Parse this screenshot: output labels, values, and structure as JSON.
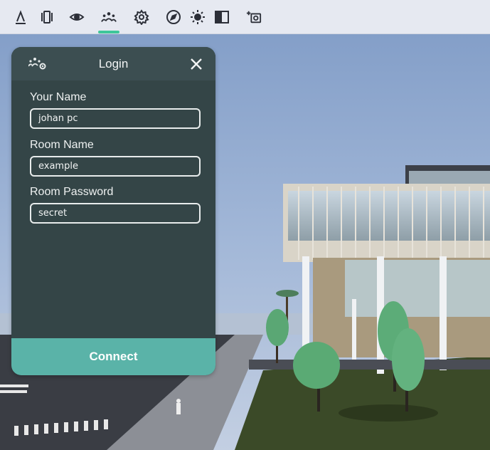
{
  "colors": {
    "panel_bg": "#344547",
    "panel_header_bg": "#3c4e51",
    "accent": "#5ab3a8",
    "active_tab_indicator": "#3ec69a",
    "toolbar_bg": "#e6e9f1",
    "toolbar_icon": "#2c2f38"
  },
  "toolbar": {
    "buttons": [
      {
        "icon": "measure-icon"
      },
      {
        "icon": "layers-icon"
      },
      {
        "icon": "eye-icon"
      },
      {
        "icon": "collaboration-icon",
        "active": true
      },
      {
        "icon": "settings-gear-icon"
      },
      {
        "icon": "compass-icon"
      },
      {
        "icon": "sun-icon"
      },
      {
        "icon": "split-view-icon"
      },
      {
        "icon": "camera-sparkle-icon"
      }
    ]
  },
  "login": {
    "title": "Login",
    "header_icon": "collaboration-settings-icon",
    "close_icon": "close-icon",
    "fields": {
      "name": {
        "label": "Your Name",
        "value": "johan pc"
      },
      "room": {
        "label": "Room Name",
        "value": "example"
      },
      "password": {
        "label": "Room Password",
        "value": "secret"
      }
    },
    "connect_label": "Connect"
  }
}
